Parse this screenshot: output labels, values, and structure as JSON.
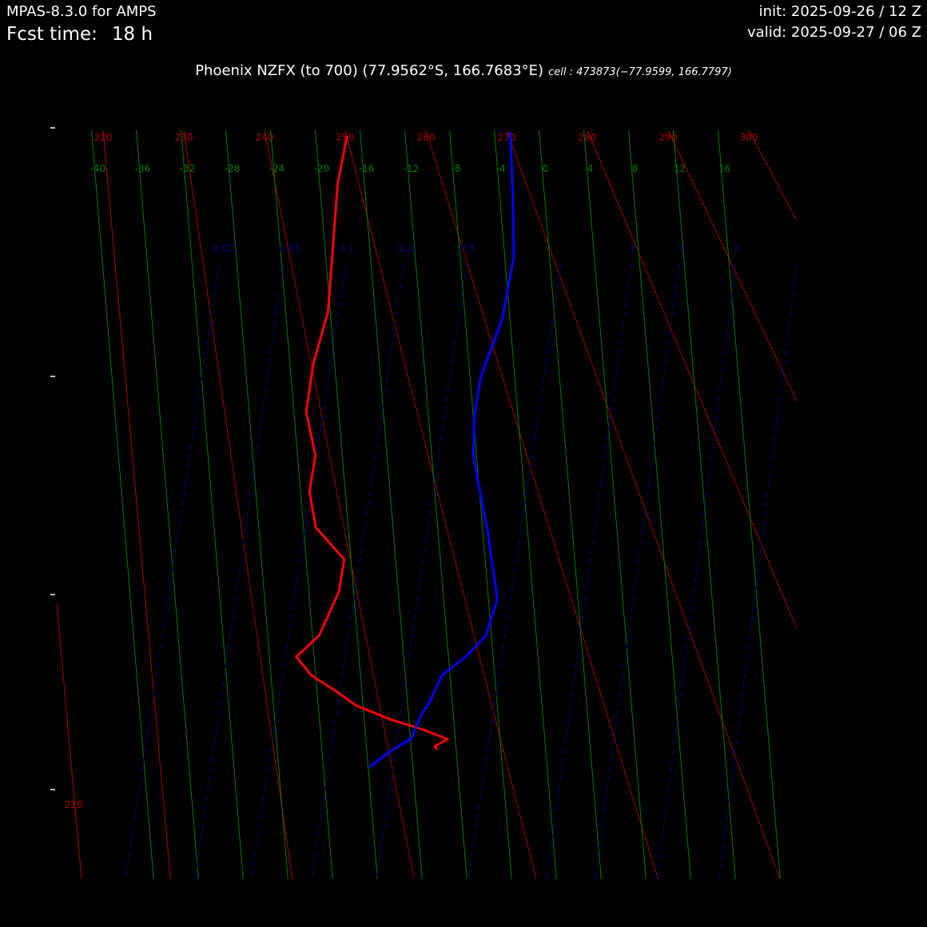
{
  "header": {
    "model": "MPAS-8.3.0 for AMPS",
    "fcst_label": "Fcst time:",
    "fcst_value": "18 h",
    "init": "init: 2025-09-26 / 12 Z",
    "valid": "valid: 2025-09-27 / 06 Z"
  },
  "title": {
    "main": "Phoenix NZFX (to 700)  (77.9562°S, 166.7683°E)",
    "cell": "cell : 473873(−77.9599, 166.7797)"
  },
  "colors": {
    "background": "#000000",
    "temperature": "#ff0000",
    "dewpoint": "#0000ff",
    "dry_adiabat": "#b00000",
    "isotherm": "#008000",
    "mixing_ratio": "#000080"
  },
  "chart_data": {
    "type": "line",
    "diagram": "skew-T log-p (lower troposphere, to 700 hPa)",
    "title": "Phoenix NZFX (to 700)  (77.9562°S, 166.7683°E)",
    "yaxis": {
      "scale": "log",
      "ticks": [
        "",
        "",
        "",
        ""
      ]
    },
    "dry_adiabats_K": [
      210,
      220,
      230,
      240,
      250,
      260,
      270,
      280,
      290,
      300
    ],
    "isotherms_C": [
      -40,
      -36,
      -32,
      -28,
      -24,
      -20,
      -16,
      -12,
      -8,
      -4,
      0,
      4,
      8,
      12,
      16
    ],
    "mixing_ratio_labels": [
      "0.02",
      "0.05",
      "0.1",
      "0.2",
      "0.5",
      "1",
      "2",
      "3",
      "5"
    ],
    "series": [
      {
        "color": "#ff0000",
        "x": [
          -17.2,
          -18.4,
          -20.2,
          -21.9,
          -22.9,
          -22.4,
          -23.2,
          -22.9,
          -20.6,
          -21.3,
          -23.4,
          -25.6,
          -24.4,
          -22.2,
          -20.6,
          -17.7,
          -14.8,
          -12.7,
          -13.9,
          -13.7
        ],
        "y": [
          170,
          230,
          390,
          455,
          515,
          570,
          615,
          660,
          700,
          740,
          795,
          822,
          845,
          866,
          883,
          900,
          913,
          925,
          934,
          938
        ],
        "name": ""
      },
      {
        "color": "#0000ff",
        "x": [
          -2.6,
          -2.8,
          -3.2,
          -4.7,
          -7.0,
          -7.9,
          -8.3,
          -7.6,
          -7.2,
          -8.5,
          -10.3,
          -12.7,
          -14.1,
          -14.9,
          -15.9,
          -17.9,
          -19.9
        ],
        "y": [
          165,
          240,
          322,
          400,
          470,
          520,
          570,
          660,
          750,
          795,
          820,
          845,
          880,
          895,
          924,
          940,
          960
        ],
        "name": ""
      }
    ]
  }
}
